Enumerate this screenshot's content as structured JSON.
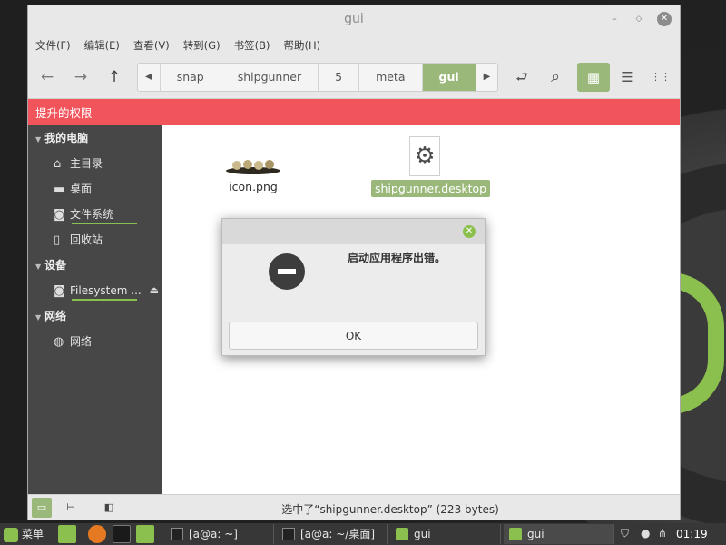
{
  "window": {
    "title": "gui",
    "controls": {
      "minimize": "–",
      "maximize": "◇",
      "close": "✕"
    }
  },
  "menubar": [
    "文件(F)",
    "编辑(E)",
    "查看(V)",
    "转到(G)",
    "书签(B)",
    "帮助(H)"
  ],
  "toolbar": {
    "back_icon": "←",
    "forward_icon": "→",
    "up_icon": "↑",
    "breadcrumbs": [
      "snap",
      "shipgunner",
      "5",
      "meta",
      "gui"
    ],
    "active_crumb": "gui",
    "crumb_left": "◀",
    "crumb_right": "▶",
    "toggle_path_icon": "⮐",
    "search_icon": "⌕",
    "view_icons": [
      "▦",
      "☰",
      "⋮⋮"
    ]
  },
  "banner": {
    "text": "提升的权限"
  },
  "sidebar": {
    "sections": [
      {
        "title": "我的电脑",
        "items": [
          {
            "label": "主目录",
            "icon": "home-icon",
            "glyph": "⌂"
          },
          {
            "label": "桌面",
            "icon": "desktop-icon",
            "glyph": "▬"
          },
          {
            "label": "文件系统",
            "icon": "filesystem-icon",
            "glyph": "◙",
            "underline": true
          },
          {
            "label": "回收站",
            "icon": "trash-icon",
            "glyph": "▯"
          }
        ]
      },
      {
        "title": "设备",
        "items": [
          {
            "label": "Filesystem ...",
            "icon": "drive-icon",
            "glyph": "◙",
            "underline": true,
            "eject": "⏏"
          }
        ]
      },
      {
        "title": "网络",
        "items": [
          {
            "label": "网络",
            "icon": "network-icon",
            "glyph": "◍"
          }
        ]
      }
    ]
  },
  "files": [
    {
      "name": "icon.png",
      "selected": false
    },
    {
      "name": "shipgunner.desktop",
      "selected": true,
      "glyph": "⚙"
    }
  ],
  "statusbar": {
    "text": "选中了“shipgunner.desktop” (223 bytes)",
    "btn_places": "▭",
    "btn_tree": "⊢",
    "btn_hide": "◧"
  },
  "dialog": {
    "message": "启动应用程序出错。",
    "ok_label": "OK",
    "close_glyph": "✕"
  },
  "panel": {
    "menu_label": "菜单",
    "tasks": [
      {
        "label": "[a@a: ~]",
        "icon": "terminal-icon"
      },
      {
        "label": "[a@a: ~/桌面]",
        "icon": "terminal-icon"
      },
      {
        "label": "gui",
        "icon": "folder-icon"
      },
      {
        "label": "gui",
        "icon": "folder-icon"
      }
    ],
    "clock": "01:19",
    "accent": "#8cc04e"
  }
}
